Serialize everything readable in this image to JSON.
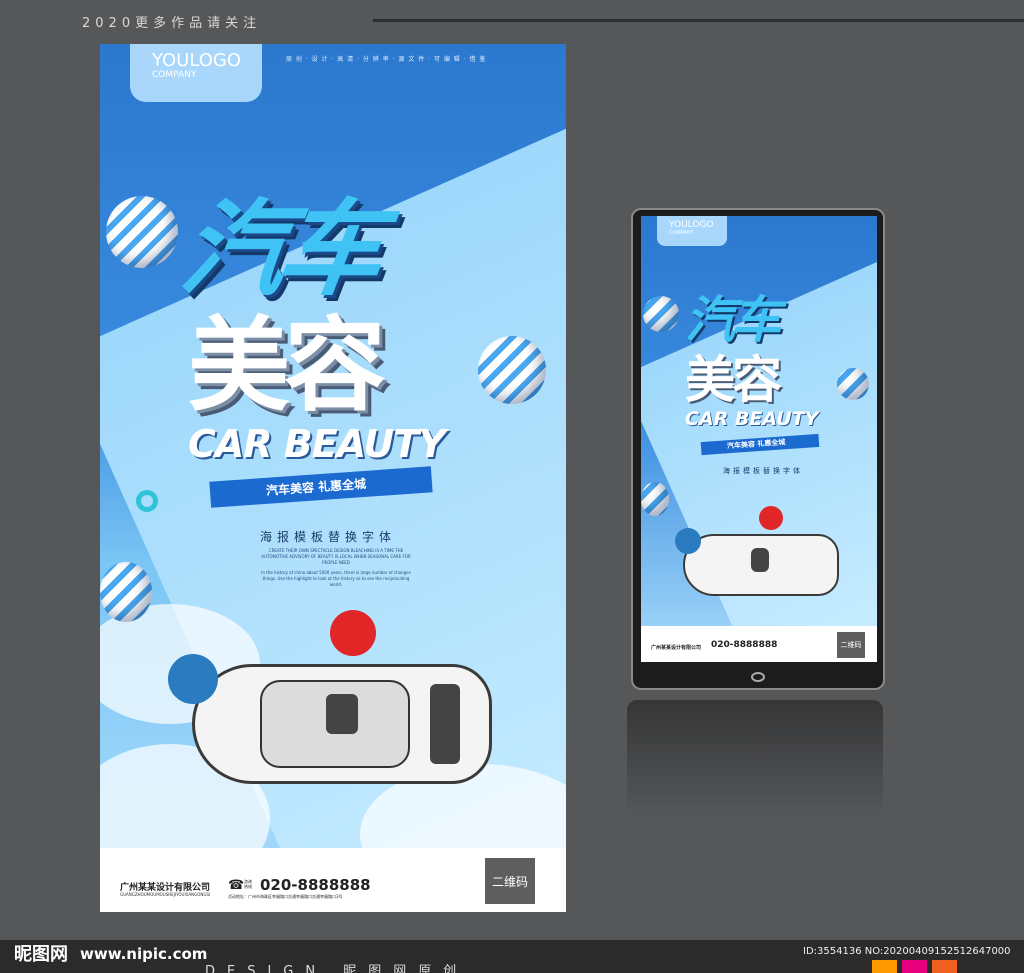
{
  "header": {
    "text": "2020更多作品请关注"
  },
  "poster": {
    "logo_main": "YOULOGO",
    "logo_sub": "COMPANY",
    "top_nav": "原 创 · 设 计 · 高 清 · 分 辨 率 · 源 文 件 · 可 编 辑 · 借 鉴",
    "title_line1": "汽车",
    "title_line2": "美容",
    "title_en": "CAR BEAUTY",
    "ribbon": "汽车美容 礼惠全城",
    "subtitle": "海报模板替换字体",
    "small_en_1": "CREATE THEIR OWN SPECTACLE DESIGN BLEACHING IS A TIME THE AUTOMOTIVE ADVISORY OF BEAUTY IS LOCAL WHEN SEASONAL CARE FOR PEOPLE NEED",
    "small_en_2": "In the history of china about 5000 years, there is large number of changes things. Use the highlight to look at the history so to see the reciprocating world.",
    "company": "广州某某设计有限公司",
    "company_en": "GUANGZHOUMOUMOUSHEJIYOUXIANGONGSI",
    "phone_label_1": "咨询",
    "phone_label_2": "热线",
    "phone": "020-8888888",
    "address": "活动地址：广州市海珠区幸福路口交通幸福路口交通幸福路口3号",
    "qr": "二维码"
  },
  "mock": {
    "logo_main": "YOULOGO",
    "logo_sub": "COMPANY",
    "title_line1": "汽车",
    "title_line2": "美容",
    "title_en": "CAR BEAUTY",
    "ribbon": "汽车美容 礼惠全城",
    "subtitle": "海报模板替换字体",
    "company": "广州某某设计有限公司",
    "phone": "020-8888888",
    "qr": "二维码"
  },
  "footer": {
    "site_logo": "昵图网",
    "site_url": "www.nipic.com",
    "design": "DESIGN 昵图网原创",
    "id": "ID:3554136 NO:20200409152512647000"
  },
  "colors": {
    "accent": "#2c78cf",
    "sky": "#a9dcfb",
    "swatch_1": "#ff9900",
    "swatch_2": "#e6007e",
    "swatch_3": "#f06020"
  }
}
